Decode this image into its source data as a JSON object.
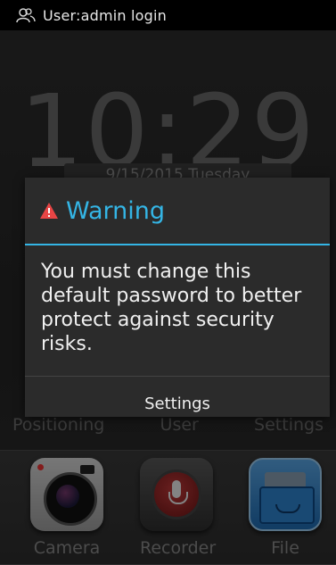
{
  "status_bar": {
    "user_text": "User:admin login",
    "icon": "user-group-icon"
  },
  "home": {
    "clock": "10:29",
    "date": "9/15/2015 Tuesday"
  },
  "dock": {
    "top_labels": [
      "Positioning",
      "User",
      "Settings"
    ],
    "apps": [
      {
        "label": "Camera",
        "icon": "camera-icon"
      },
      {
        "label": "Recorder",
        "icon": "microphone-icon"
      },
      {
        "label": "File",
        "icon": "file-cabinet-icon"
      }
    ]
  },
  "dialog": {
    "icon": "warning-triangle-icon",
    "title": "Warning",
    "message": "You must change this default password to better protect against security risks.",
    "button_label": "Settings",
    "accent_color": "#34b5e5",
    "warning_color": "#e84545"
  }
}
